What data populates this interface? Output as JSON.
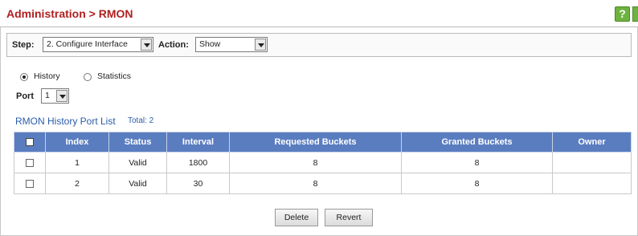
{
  "header": {
    "title": "Administration > RMON",
    "help_label": "?"
  },
  "stepbar": {
    "step_label": "Step:",
    "step_value": "2. Configure Interface",
    "action_label": "Action:",
    "action_value": "Show"
  },
  "mode": {
    "history_label": "History",
    "statistics_label": "Statistics",
    "selected": "History"
  },
  "port": {
    "label": "Port",
    "value": "1"
  },
  "list": {
    "title": "RMON History Port List",
    "total": "Total: 2",
    "columns": [
      "Index",
      "Status",
      "Interval",
      "Requested Buckets",
      "Granted Buckets",
      "Owner"
    ],
    "rows": [
      {
        "index": "1",
        "status": "Valid",
        "interval": "1800",
        "requested": "8",
        "granted": "8",
        "owner": ""
      },
      {
        "index": "2",
        "status": "Valid",
        "interval": "30",
        "requested": "8",
        "granted": "8",
        "owner": ""
      }
    ]
  },
  "buttons": {
    "delete": "Delete",
    "revert": "Revert"
  },
  "colors": {
    "title": "#b02020",
    "table_header": "#5a7dc0",
    "list_title": "#2a5caa",
    "help": "#6db33f"
  }
}
